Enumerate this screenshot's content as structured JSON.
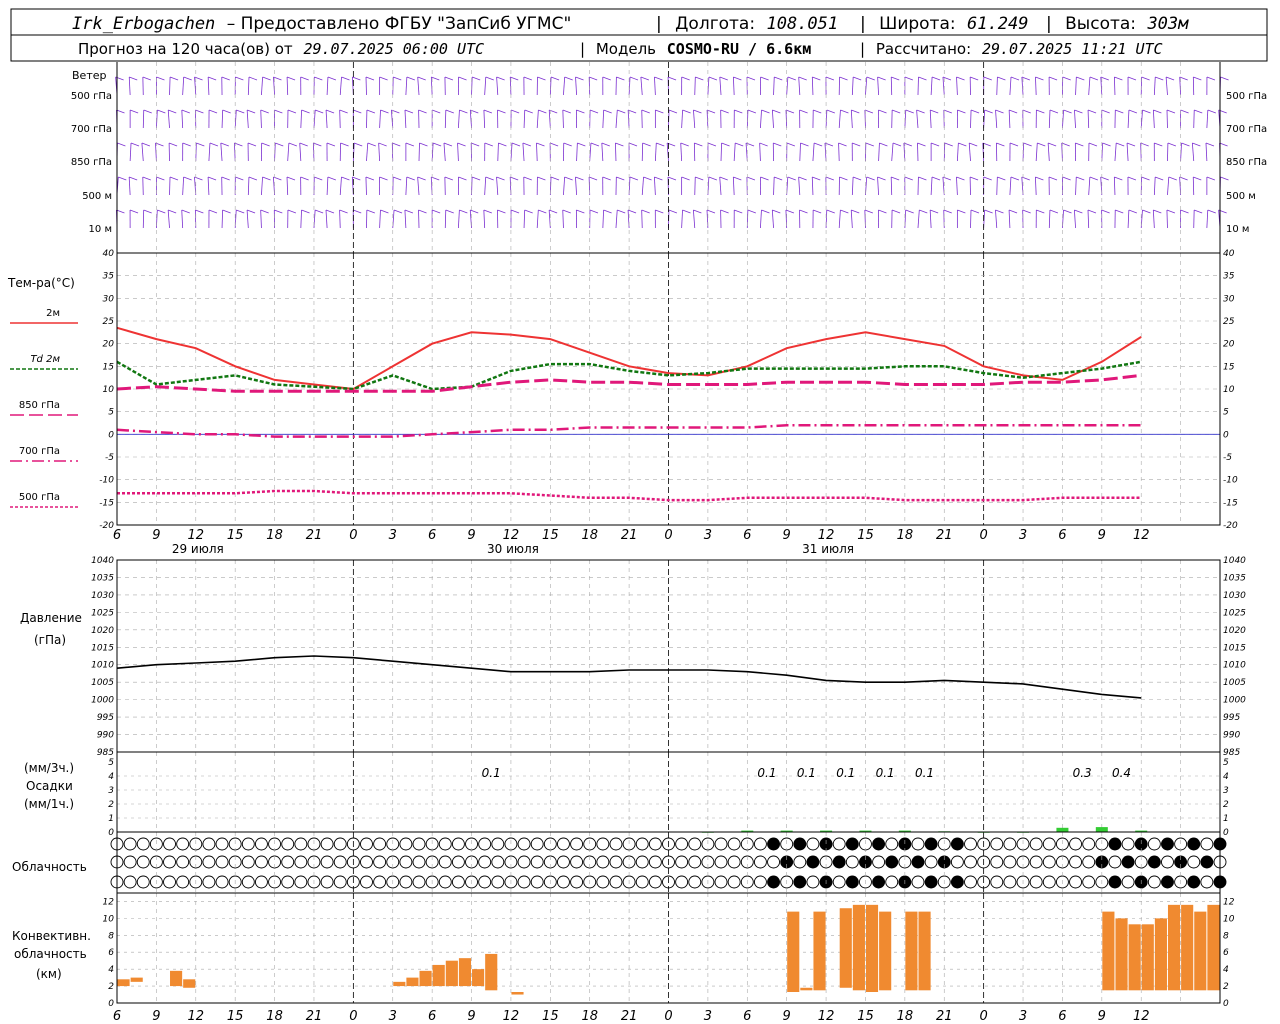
{
  "header": {
    "station": "Irk_Erbogachen",
    "provider": "– Предоставлено ФГБУ \"ЗапСиб УГМС\"",
    "lon_label": "Долгота:",
    "lon_value": "108.051",
    "lat_label": "Широта:",
    "lat_value": "61.249",
    "alt_label": "Высота:",
    "alt_value": "303м",
    "forecast_label": "Прогноз на 120 часа(ов) от",
    "forecast_from": "29.07.2025 06:00 UTC",
    "model_label": "Модель",
    "model_name": "COSMO-RU / 6.6км",
    "calc_label": "Рассчитано:",
    "calc_time": "29.07.2025 11:21 UTC"
  },
  "panels": {
    "wind": {
      "title": "Ветер",
      "levels": [
        "500 гПа",
        "700 гПа",
        "850 гПа",
        "500 м",
        "10 м"
      ]
    },
    "temperature": {
      "title": "Тем-ра(°C)",
      "legend": [
        {
          "label": "2м",
          "color": "#ee3333",
          "dash": ""
        },
        {
          "label": "Td  2м",
          "color": "#117711",
          "dash": "4,2"
        },
        {
          "label": "850 гПа",
          "color": "#e0187a",
          "dash": "14,5"
        },
        {
          "label": "700 гПа",
          "color": "#e0187a",
          "dash": "12,4,2,4"
        },
        {
          "label": "500 гПа",
          "color": "#e0187a",
          "dash": "3,2"
        }
      ]
    },
    "pressure": {
      "title": "Давление",
      "unit": "(гПа)"
    },
    "precip": {
      "unit_top": "(мм/3ч.)",
      "title": "Осадки",
      "unit_bottom": "(мм/1ч.)"
    },
    "cloud": {
      "title": "Облачность"
    },
    "conv": {
      "title_1": "Конвективн.",
      "title_2": "облачность",
      "unit": "(км)"
    }
  },
  "time_axis": {
    "hour_labels": [
      "6",
      "9",
      "12",
      "15",
      "18",
      "21",
      "0",
      "3",
      "6",
      "9",
      "12",
      "15",
      "18",
      "21",
      "0",
      "3",
      "6",
      "9",
      "12",
      "15",
      "18",
      "21",
      "0",
      "3",
      "6",
      "9",
      "12"
    ],
    "day_labels": [
      "29 июля",
      "30 июля",
      "31 июля"
    ]
  },
  "colors": {
    "wind": "#7b2fd0",
    "temp_2m": "#ee3333",
    "dewpoint": "#117711",
    "upper_air": "#e0187a",
    "precip": "#33cc33",
    "convective": "#f08a30",
    "grid": "#aaaaaa"
  },
  "chart_data": [
    {
      "type": "line",
      "ylim": [
        -20,
        40
      ],
      "yticks": [
        -20,
        -15,
        -10,
        -5,
        0,
        5,
        10,
        15,
        20,
        25,
        30,
        35,
        40
      ],
      "x_hours": [
        0,
        3,
        6,
        9,
        12,
        15,
        18,
        21,
        24,
        27,
        30,
        33,
        36,
        39,
        42,
        45,
        48,
        51,
        54,
        57,
        60,
        63,
        66,
        69,
        72,
        75,
        78
      ],
      "series": [
        {
          "name": "2м",
          "values": [
            23.5,
            21,
            19,
            15,
            12,
            11,
            10,
            15,
            20,
            22.5,
            22,
            21,
            18,
            15,
            13.5,
            13,
            15,
            19,
            21,
            22.5,
            21,
            19.5,
            15,
            13,
            12,
            16,
            21.5
          ]
        },
        {
          "name": "Td  2м",
          "values": [
            16,
            11,
            12,
            13,
            11,
            10.5,
            10,
            13,
            10,
            10.5,
            14,
            15.5,
            15.5,
            14,
            13,
            13.5,
            14.5,
            14.5,
            14.5,
            14.5,
            15,
            15,
            13.5,
            12.5,
            13.5,
            14.5,
            16
          ]
        },
        {
          "name": "850 гПа",
          "values": [
            10,
            10.5,
            10,
            9.5,
            9.5,
            9.5,
            9.5,
            9.5,
            9.5,
            10.5,
            11.5,
            12,
            11.5,
            11.5,
            11,
            11,
            11,
            11.5,
            11.5,
            11.5,
            11,
            11,
            11,
            11.5,
            11.5,
            12,
            13
          ]
        },
        {
          "name": "700 гПа",
          "values": [
            1,
            0.5,
            0,
            0,
            -0.5,
            -0.5,
            -0.5,
            -0.5,
            0,
            0.5,
            1,
            1,
            1.5,
            1.5,
            1.5,
            1.5,
            1.5,
            2,
            2,
            2,
            2,
            2,
            2,
            2,
            2,
            2,
            2
          ]
        },
        {
          "name": "500 гПа",
          "values": [
            -13,
            -13,
            -13,
            -13,
            -12.5,
            -12.5,
            -13,
            -13,
            -13,
            -13,
            -13,
            -13.5,
            -14,
            -14,
            -14.5,
            -14.5,
            -14,
            -14,
            -14,
            -14,
            -14.5,
            -14.5,
            -14.5,
            -14.5,
            -14,
            -14,
            -14
          ]
        }
      ]
    },
    {
      "type": "line",
      "ylim": [
        985,
        1040
      ],
      "yticks": [
        985,
        990,
        995,
        1000,
        1005,
        1010,
        1015,
        1020,
        1025,
        1030,
        1035,
        1040
      ],
      "x_hours": [
        0,
        3,
        6,
        9,
        12,
        15,
        18,
        21,
        24,
        27,
        30,
        33,
        36,
        39,
        42,
        45,
        48,
        51,
        54,
        57,
        60,
        63,
        66,
        69,
        72,
        75,
        78
      ],
      "series": [
        {
          "name": "Давление",
          "values": [
            1009,
            1010,
            1010.5,
            1011,
            1012,
            1012.5,
            1012,
            1011,
            1010,
            1009,
            1008,
            1008,
            1008,
            1008.5,
            1008.5,
            1008.5,
            1008,
            1007,
            1005.5,
            1005,
            1005,
            1005.5,
            1005,
            1004.5,
            1003,
            1001.5,
            1000.5
          ]
        }
      ]
    },
    {
      "type": "bar",
      "ylim": [
        0,
        5
      ],
      "yticks": [
        0,
        1,
        2,
        3,
        4,
        5
      ],
      "x_hours": [
        45,
        48,
        51,
        54,
        57,
        60,
        63,
        66,
        69,
        72,
        75,
        78
      ],
      "labels": [
        "0.1",
        "0.1",
        "0.1",
        "0.1",
        "0.1",
        "0.1",
        "0.3",
        "0.4"
      ],
      "label_hours": [
        28.5,
        49.5,
        52.5,
        55.5,
        58.5,
        61.5,
        73.5,
        76.5
      ],
      "values": [
        0.02,
        0.1,
        0.1,
        0.1,
        0.1,
        0.1,
        0.05,
        0.02,
        0.02,
        0.3,
        0.35,
        0.1
      ]
    },
    {
      "type": "bar",
      "ylim": [
        0,
        13
      ],
      "yticks": [
        0,
        2,
        4,
        6,
        8,
        10,
        12
      ],
      "bars": [
        {
          "h": 0.5,
          "bottom": 2.0,
          "top": 2.8
        },
        {
          "h": 1.5,
          "bottom": 2.5,
          "top": 3.0
        },
        {
          "h": 4.5,
          "bottom": 2.0,
          "top": 3.8
        },
        {
          "h": 5.5,
          "bottom": 1.8,
          "top": 2.8
        },
        {
          "h": 21.5,
          "bottom": 2.0,
          "top": 2.5
        },
        {
          "h": 22.5,
          "bottom": 2.0,
          "top": 3.0
        },
        {
          "h": 23.5,
          "bottom": 2.0,
          "top": 3.8
        },
        {
          "h": 24.5,
          "bottom": 2.0,
          "top": 4.5
        },
        {
          "h": 25.5,
          "bottom": 2.0,
          "top": 5.0
        },
        {
          "h": 26.5,
          "bottom": 2.0,
          "top": 5.3
        },
        {
          "h": 27.5,
          "bottom": 2.0,
          "top": 4.0
        },
        {
          "h": 28.5,
          "bottom": 1.5,
          "top": 5.8
        },
        {
          "h": 30.5,
          "bottom": 1.0,
          "top": 1.3
        },
        {
          "h": 51.5,
          "bottom": 1.3,
          "top": 10.8
        },
        {
          "h": 52.5,
          "bottom": 1.5,
          "top": 1.8
        },
        {
          "h": 53.5,
          "bottom": 1.5,
          "top": 10.8
        },
        {
          "h": 55.5,
          "bottom": 1.8,
          "top": 11.2
        },
        {
          "h": 56.5,
          "bottom": 1.5,
          "top": 11.6
        },
        {
          "h": 57.5,
          "bottom": 1.3,
          "top": 11.6
        },
        {
          "h": 58.5,
          "bottom": 1.5,
          "top": 10.8
        },
        {
          "h": 60.5,
          "bottom": 1.5,
          "top": 10.8
        },
        {
          "h": 61.5,
          "bottom": 1.5,
          "top": 10.8
        },
        {
          "h": 75.5,
          "bottom": 1.5,
          "top": 10.8
        },
        {
          "h": 76.5,
          "bottom": 1.5,
          "top": 10.0
        },
        {
          "h": 77.5,
          "bottom": 1.5,
          "top": 9.3
        },
        {
          "h": 78.5,
          "bottom": 1.5,
          "top": 9.3
        },
        {
          "h": 79.5,
          "bottom": 1.5,
          "top": 10.0
        },
        {
          "h": 80.5,
          "bottom": 1.5,
          "top": 11.6
        },
        {
          "h": 81.5,
          "bottom": 1.5,
          "top": 11.6
        },
        {
          "h": 82.5,
          "bottom": 1.5,
          "top": 10.8
        },
        {
          "h": 83.5,
          "bottom": 1.5,
          "top": 11.6
        }
      ]
    }
  ]
}
